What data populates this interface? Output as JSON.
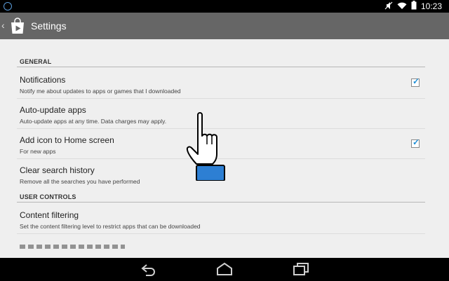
{
  "status": {
    "time": "10:23",
    "icons": [
      "notification-icon",
      "mute-icon",
      "wifi-icon",
      "battery-icon"
    ]
  },
  "header": {
    "title": "Settings",
    "icons": [
      "back-chevron-icon",
      "play-store-logo"
    ]
  },
  "sections": {
    "general": "GENERAL",
    "user_controls": "USER CONTROLS"
  },
  "items": [
    {
      "title": "Notifications",
      "subtitle": "Notify me about updates to apps or games that I downloaded",
      "checked": true
    },
    {
      "title": "Auto-update apps",
      "subtitle": "Auto-update apps at any time. Data charges may apply."
    },
    {
      "title": "Add icon to Home screen",
      "subtitle": "For new apps",
      "checked": true
    },
    {
      "title": "Clear search history",
      "subtitle": "Remove all the searches you have performed"
    },
    {
      "title": "Content filtering",
      "subtitle": "Set the content filtering level to restrict apps that can be downloaded"
    }
  ],
  "navbar": {
    "icons": [
      "back-icon",
      "home-icon",
      "recents-icon"
    ]
  },
  "overlay": {
    "icon": "pointing-hand-icon"
  },
  "colors": {
    "accent": "#1f8fd6",
    "actionbar": "#666666",
    "background": "#efefef"
  }
}
